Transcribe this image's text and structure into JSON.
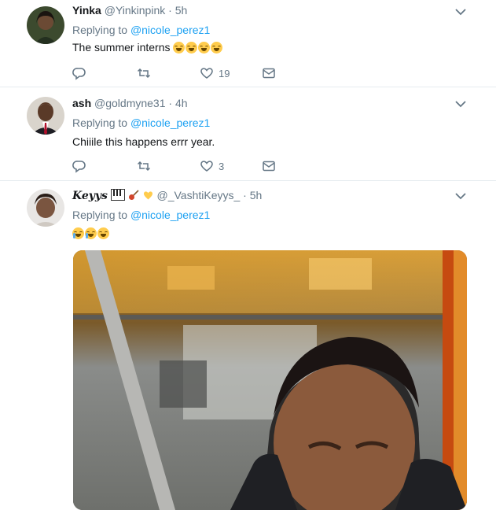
{
  "tweets": [
    {
      "name": "Yinka",
      "handle": "@Yinkinpink",
      "dot": "·",
      "time": "5h",
      "replying_prefix": "Replying to",
      "replying_to": "@nicole_perez1",
      "text": "The summer interns",
      "emojis": [
        "face-with-tears-of-joy",
        "face-with-tears-of-joy",
        "face-with-tears-of-joy",
        "face-with-tears-of-joy"
      ],
      "like_count": "19"
    },
    {
      "name": "ash",
      "handle": "@goldmyne31",
      "dot": "·",
      "time": "4h",
      "replying_prefix": "Replying to",
      "replying_to": "@nicole_perez1",
      "text": "Chiiile this happens errr year.",
      "like_count": "3"
    },
    {
      "name": "Keyys",
      "name_emojis": [
        "musical-keyboard",
        "guitar",
        "yellow-heart"
      ],
      "handle": "@_VashtiKeyys_",
      "dot": "·",
      "time": "5h",
      "replying_prefix": "Replying to",
      "replying_to": "@nicole_perez1",
      "emojis": [
        "loudly-crying-face",
        "loudly-crying-face",
        "face-with-tears-of-joy"
      ],
      "media": "video-thumbnail"
    }
  ],
  "icons": [
    "chevron-down-icon",
    "reply-icon",
    "retweet-icon",
    "like-icon",
    "direct-message-icon"
  ],
  "colors": {
    "accent": "#1da1f2",
    "muted": "#657786",
    "text": "#14171a",
    "divider": "#e6ecf0"
  }
}
